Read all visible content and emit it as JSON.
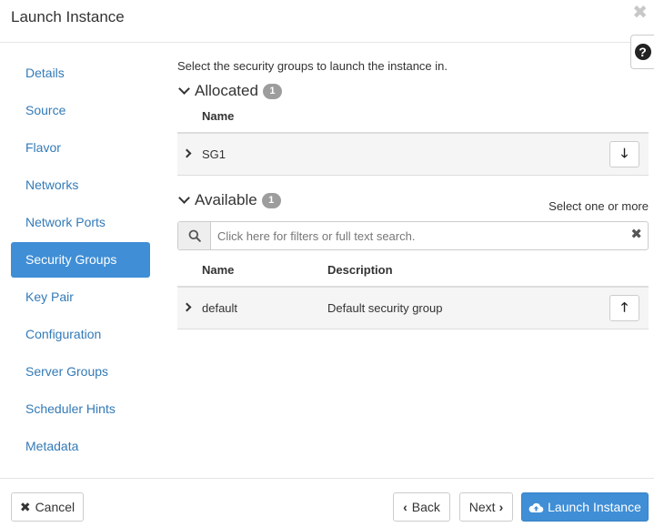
{
  "modal": {
    "title": "Launch Instance",
    "close_glyph": "✖",
    "help_glyph": "?"
  },
  "sidebar": {
    "items": [
      {
        "label": "Details",
        "active": false
      },
      {
        "label": "Source",
        "active": false
      },
      {
        "label": "Flavor",
        "active": false
      },
      {
        "label": "Networks",
        "active": false
      },
      {
        "label": "Network Ports",
        "active": false
      },
      {
        "label": "Security Groups",
        "active": true
      },
      {
        "label": "Key Pair",
        "active": false
      },
      {
        "label": "Configuration",
        "active": false
      },
      {
        "label": "Server Groups",
        "active": false
      },
      {
        "label": "Scheduler Hints",
        "active": false
      },
      {
        "label": "Metadata",
        "active": false
      }
    ]
  },
  "main": {
    "intro": "Select the security groups to launch the instance in.",
    "allocated": {
      "title": "Allocated",
      "count": "1",
      "column_name": "Name",
      "rows": [
        {
          "name": "SG1",
          "action_icon": "arrow-down-icon",
          "action_glyph": "🡓"
        }
      ]
    },
    "available": {
      "title": "Available",
      "count": "1",
      "select_hint": "Select one or more",
      "search": {
        "placeholder": "Click here for filters or full text search.",
        "value": "",
        "clear_glyph": "✖"
      },
      "column_name": "Name",
      "column_description": "Description",
      "rows": [
        {
          "name": "default",
          "description": "Default security group",
          "action_icon": "arrow-up-icon",
          "action_glyph": "🡑"
        }
      ]
    }
  },
  "footer": {
    "cancel_label": "Cancel",
    "cancel_glyph": "✖",
    "back_label": "Back",
    "back_glyph": "‹",
    "next_label": "Next",
    "next_glyph": "›",
    "launch_label": "Launch Instance"
  },
  "colors": {
    "accent": "#3f8ed6",
    "link": "#337ab7",
    "badge": "#9d9d9d",
    "row_bg": "#f5f5f5"
  }
}
